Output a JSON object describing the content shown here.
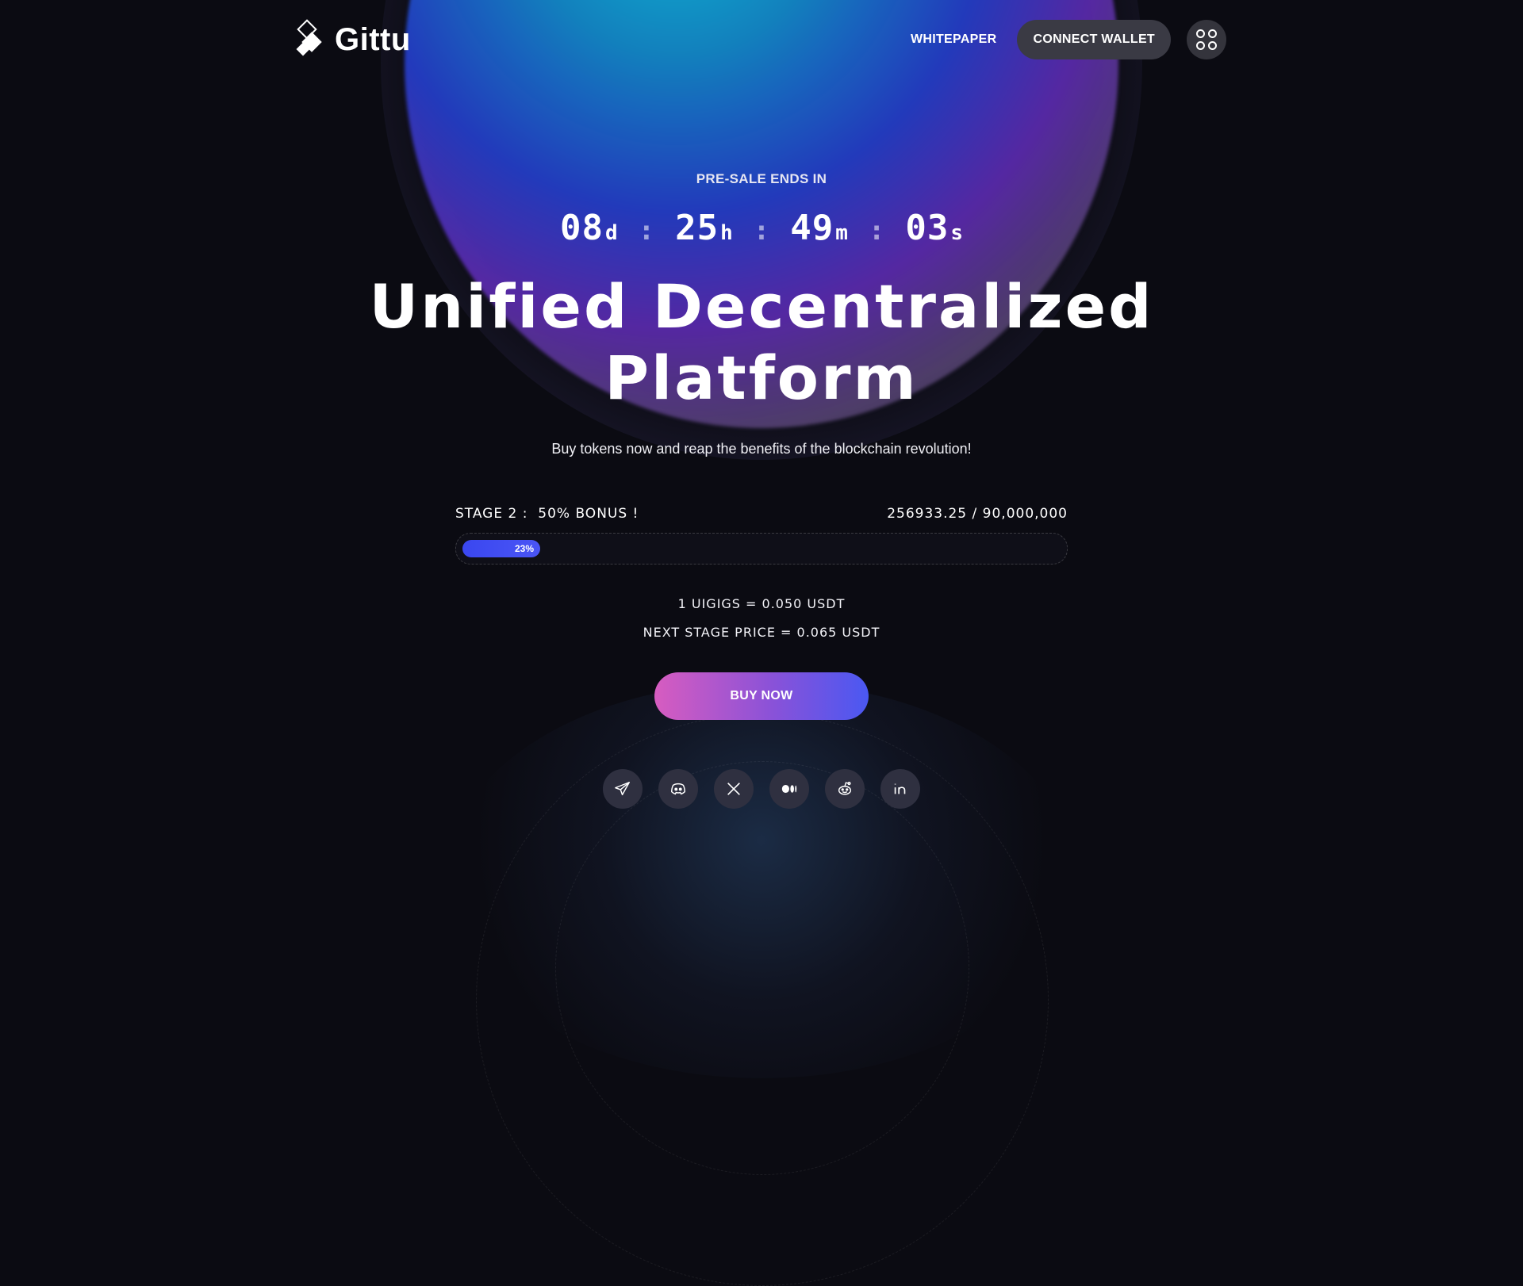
{
  "brand": {
    "name": "Gittu"
  },
  "nav": {
    "whitepaper": "WHITEPAPER",
    "connect_wallet": "CONNECT WALLET"
  },
  "presale": {
    "label": "PRE-SALE ENDS IN",
    "days": "08",
    "days_unit": "d",
    "hours": "25",
    "hours_unit": "h",
    "minutes": "49",
    "minutes_unit": "m",
    "seconds": "03",
    "seconds_unit": "s",
    "separator": ":"
  },
  "hero": {
    "title_line1": "Unified Decentralized",
    "title_line2": "Platform",
    "subtitle": "Buy tokens now and reap the benefits of the blockchain revolution!"
  },
  "stage": {
    "label": "STAGE 2 :  50% BONUS !",
    "raised": "256933.25 / 90,000,000",
    "progress_label": "23%",
    "progress_fraction": 0.13
  },
  "pricing": {
    "current": "1 UIGIGS = 0.050 USDT",
    "next": "NEXT STAGE PRICE = 0.065 USDT"
  },
  "cta": {
    "buy_now": "BUY NOW"
  },
  "socials": [
    "telegram-icon",
    "discord-icon",
    "x-icon",
    "medium-icon",
    "reddit-icon",
    "linkedin-icon"
  ],
  "colors": {
    "accent": "#4a55f5",
    "pink": "#d75cc0",
    "background": "#0b0b12"
  }
}
